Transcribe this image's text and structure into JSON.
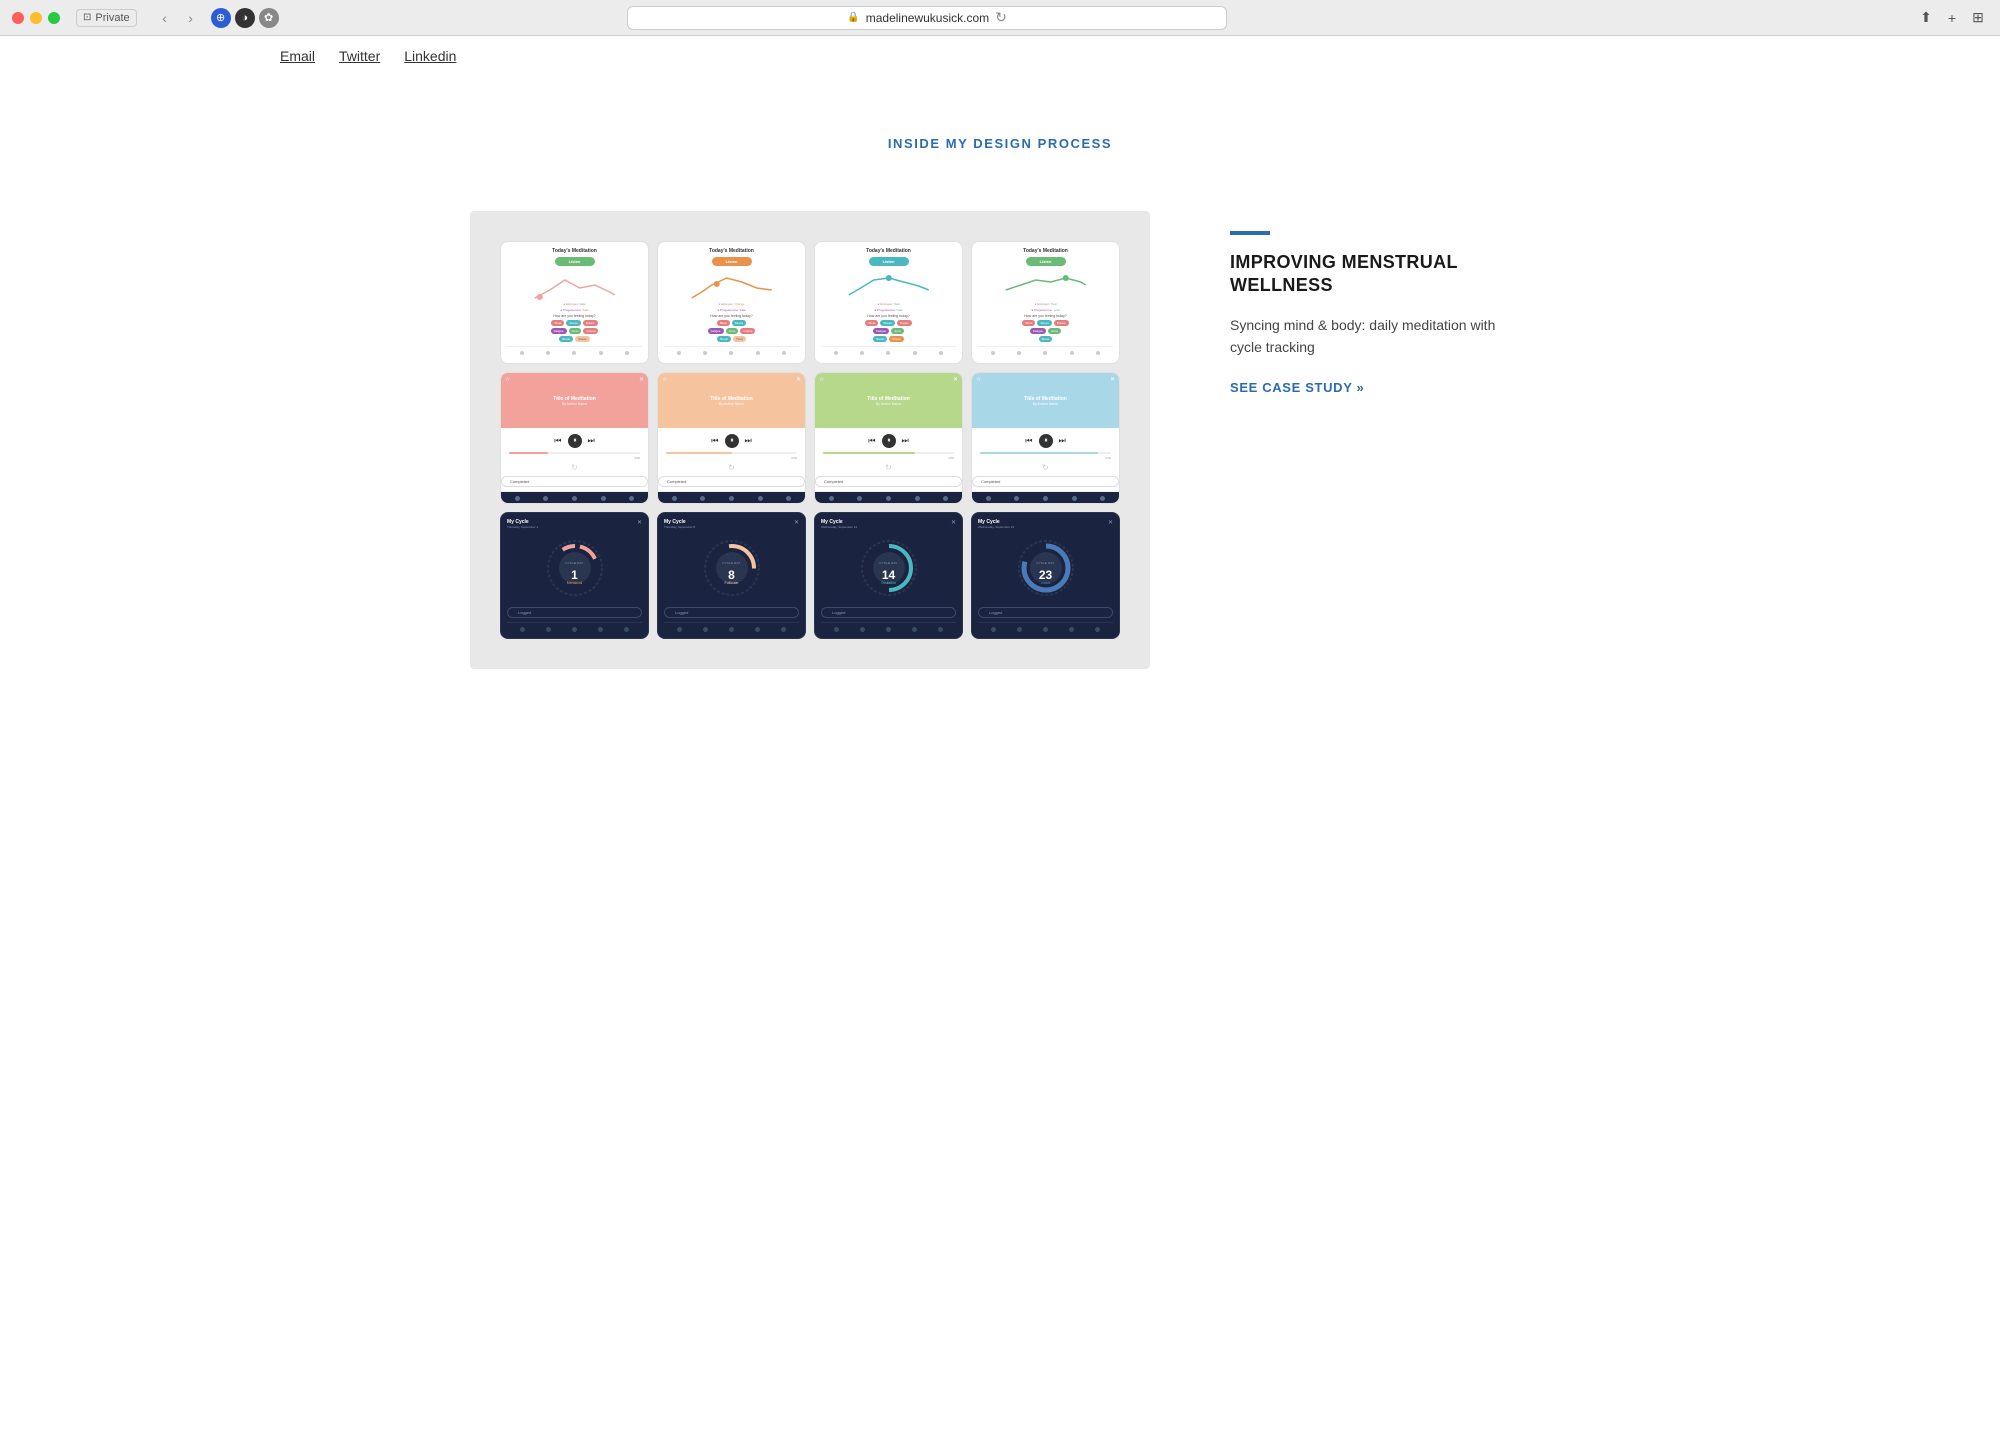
{
  "browser": {
    "url": "madelinewukusick.com",
    "private_label": "Private"
  },
  "nav": {
    "email_label": "Email",
    "twitter_label": "Twitter",
    "linkedin_label": "Linkedin"
  },
  "section": {
    "heading": "INSIDE MY DESIGN PROCESS"
  },
  "project": {
    "accent_color": "#2b6cb0",
    "title": "IMPROVING MENSTRUAL WELLNESS",
    "description": "Syncing mind & body: daily meditation with cycle tracking",
    "case_study_label": "SEE CASE STUDY »"
  },
  "cards": {
    "row1_title": "Today's Meditation",
    "listen_btn": "Listen",
    "row2_title": "Title of Meditation",
    "row2_author": "By Author Name",
    "completed_btn": "Completed",
    "row3_title": "My Cycle",
    "logged_btn": "Logged",
    "dates": [
      "Thursday, September 1",
      "Thursday, September 8",
      "Wednesday, September 14",
      "Wednesday, September 23"
    ],
    "cycle_days": [
      "1",
      "8",
      "14",
      "23"
    ],
    "cycle_day_label": "CYCLE DAY",
    "phases": [
      "Menstrual",
      "Follicular",
      "Ovulation",
      "Luteal"
    ]
  }
}
